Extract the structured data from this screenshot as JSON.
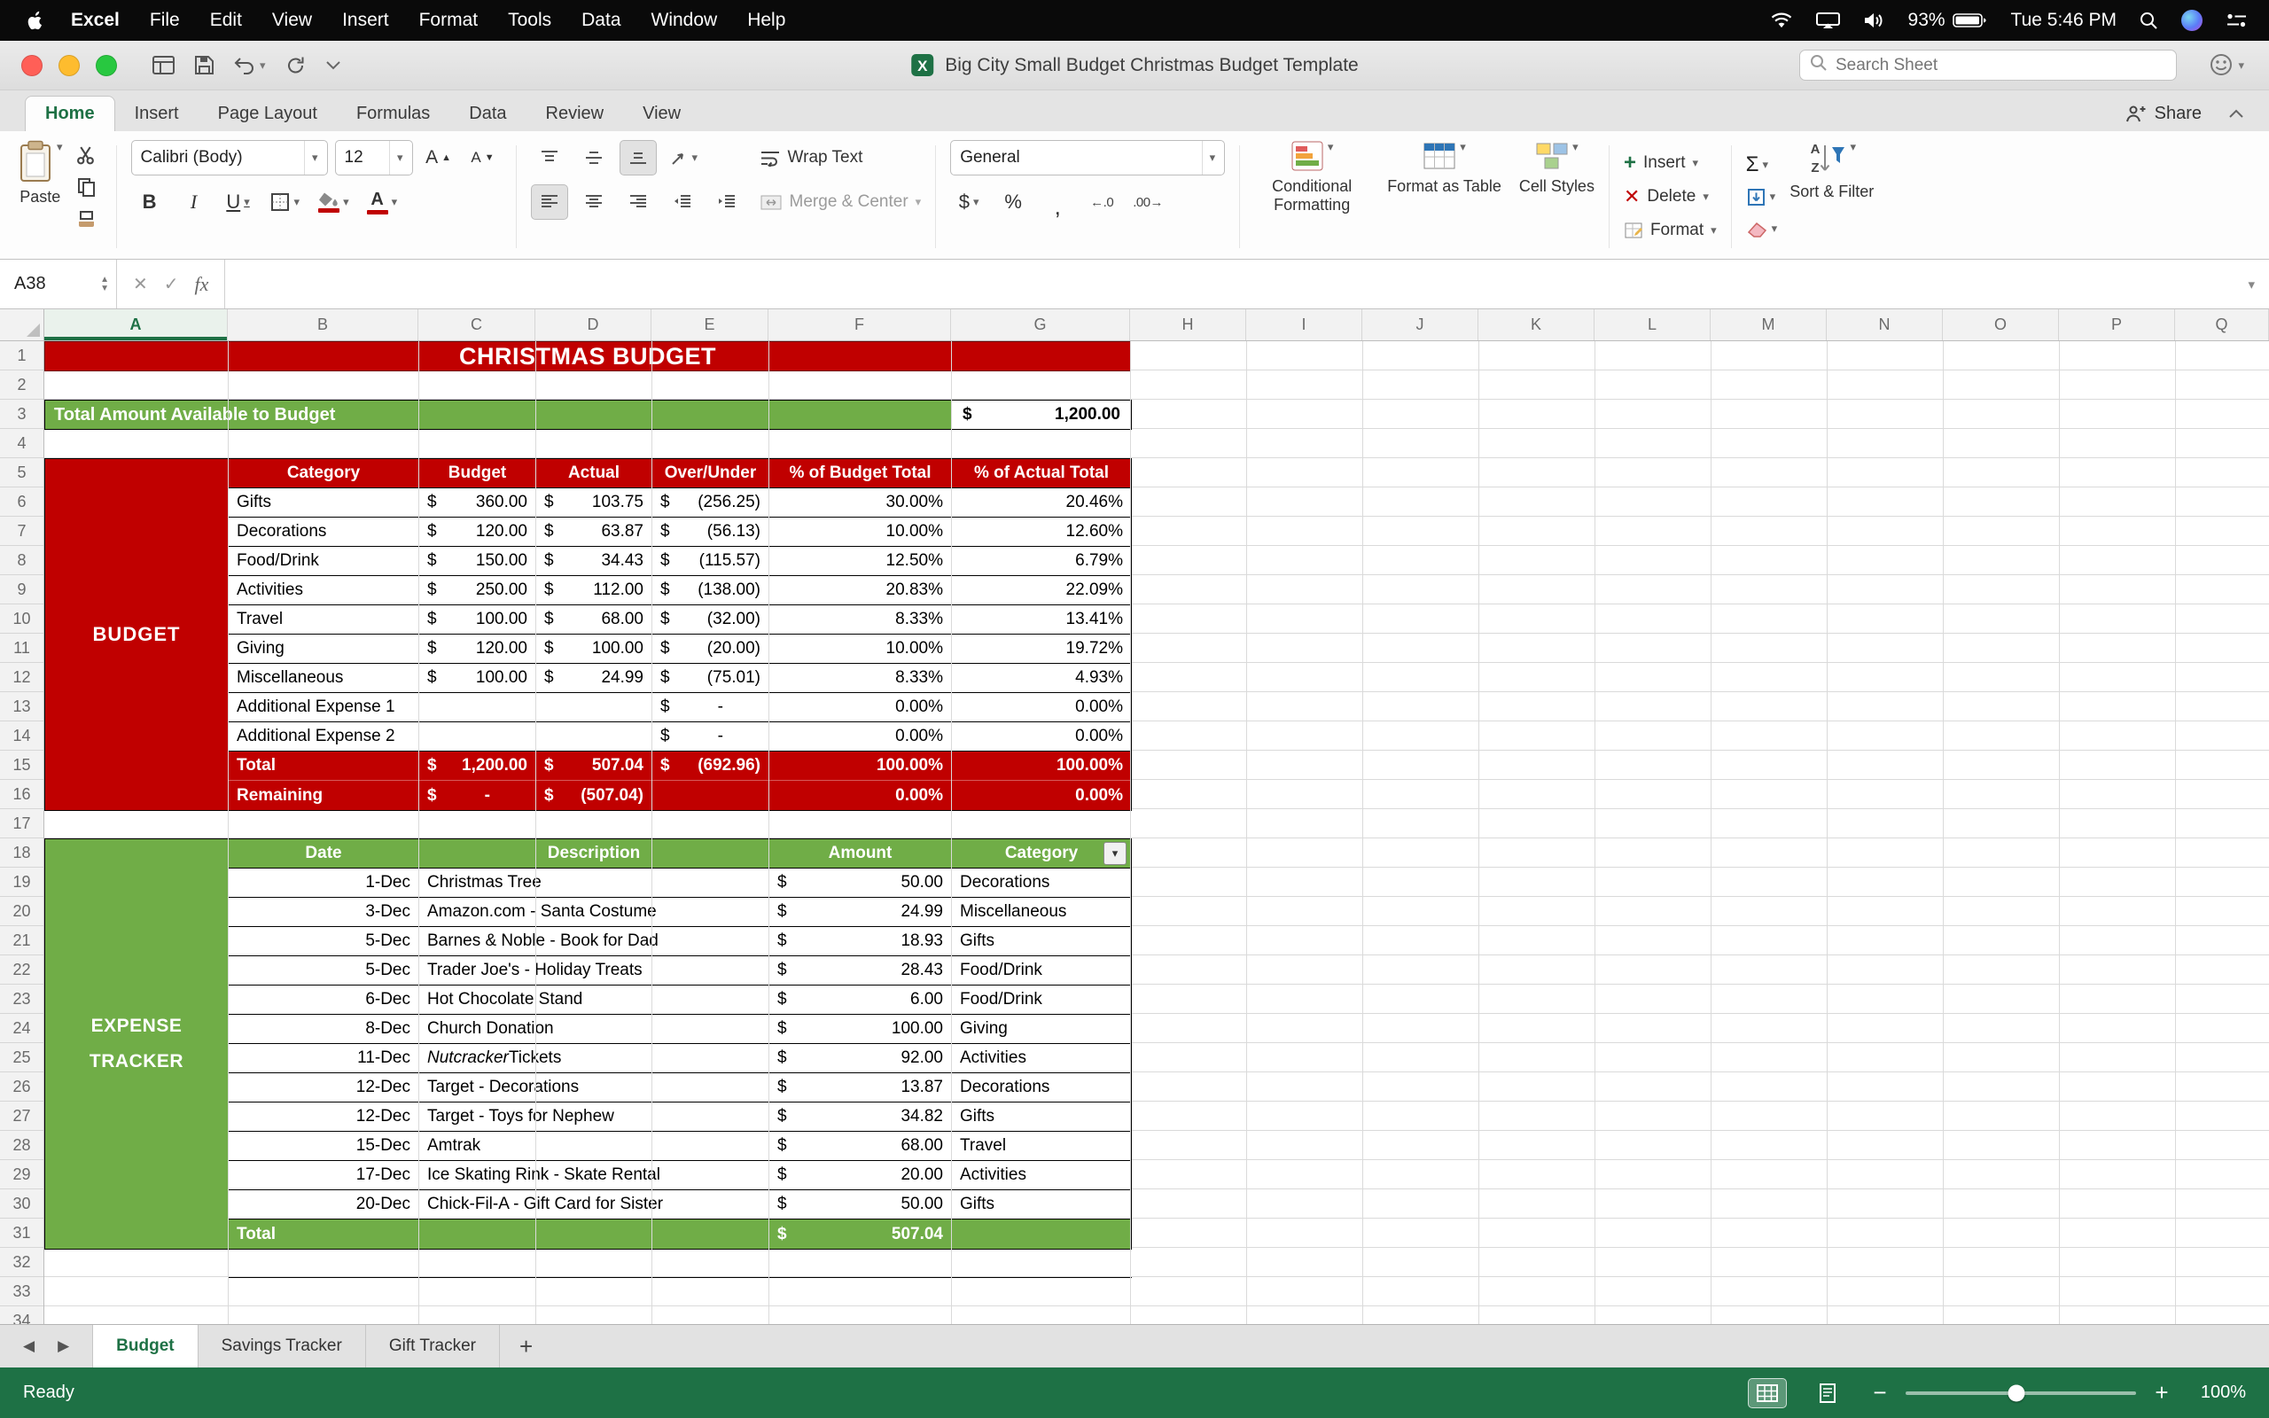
{
  "menubar": {
    "app": "Excel",
    "items": [
      "File",
      "Edit",
      "View",
      "Insert",
      "Format",
      "Tools",
      "Data",
      "Window",
      "Help"
    ],
    "battery": "93%",
    "clock": "Tue 5:46 PM"
  },
  "titlebar": {
    "doc_title": "Big City Small Budget Christmas Budget Template",
    "search_placeholder": "Search Sheet"
  },
  "ribbon": {
    "tabs": [
      "Home",
      "Insert",
      "Page Layout",
      "Formulas",
      "Data",
      "Review",
      "View"
    ],
    "active_tab": "Home",
    "share": "Share",
    "paste": "Paste",
    "font_name": "Calibri (Body)",
    "font_size": "12",
    "wrap_text": "Wrap Text",
    "merge_center": "Merge & Center",
    "number_format": "General",
    "conditional_formatting": "Conditional Formatting",
    "format_as_table": "Format as Table",
    "cell_styles": "Cell Styles",
    "insert": "Insert",
    "delete": "Delete",
    "format": "Format",
    "sort_filter": "Sort & Filter"
  },
  "formula_bar": {
    "name_box": "A38",
    "fx": "fx"
  },
  "grid": {
    "columns": [
      "A",
      "B",
      "C",
      "D",
      "E",
      "F",
      "G",
      "H",
      "I",
      "J",
      "K",
      "L",
      "M",
      "N",
      "O",
      "P",
      "Q"
    ],
    "selected_column": "A",
    "row_count": 34
  },
  "sheet": {
    "currency": "$",
    "title": "CHRISTMAS BUDGET",
    "available": {
      "label": "Total Amount Available to Budget",
      "currency": "$",
      "amount": "1,200.00"
    },
    "budget": {
      "side_label": "BUDGET",
      "headers": [
        "Category",
        "Budget",
        "Actual",
        "Over/Under",
        "% of Budget Total",
        "% of Actual Total"
      ],
      "rows": [
        {
          "kind": "data",
          "category": "Gifts",
          "budget": "360.00",
          "actual": "103.75",
          "over": "(256.25)",
          "pctb": "30.00%",
          "pcta": "20.46%"
        },
        {
          "kind": "data",
          "category": "Decorations",
          "budget": "120.00",
          "actual": "63.87",
          "over": "(56.13)",
          "pctb": "10.00%",
          "pcta": "12.60%"
        },
        {
          "kind": "data",
          "category": "Food/Drink",
          "budget": "150.00",
          "actual": "34.43",
          "over": "(115.57)",
          "pctb": "12.50%",
          "pcta": "6.79%"
        },
        {
          "kind": "data",
          "category": "Activities",
          "budget": "250.00",
          "actual": "112.00",
          "over": "(138.00)",
          "pctb": "20.83%",
          "pcta": "22.09%"
        },
        {
          "kind": "data",
          "category": "Travel",
          "budget": "100.00",
          "actual": "68.00",
          "over": "(32.00)",
          "pctb": "8.33%",
          "pcta": "13.41%"
        },
        {
          "kind": "data",
          "category": "Giving",
          "budget": "120.00",
          "actual": "100.00",
          "over": "(20.00)",
          "pctb": "10.00%",
          "pcta": "19.72%"
        },
        {
          "kind": "data",
          "category": "Miscellaneous",
          "budget": "100.00",
          "actual": "24.99",
          "over": "(75.01)",
          "pctb": "8.33%",
          "pcta": "4.93%"
        },
        {
          "kind": "plain",
          "category": "Additional Expense 1",
          "budget": "",
          "actual": "",
          "over": "-",
          "pctb": "0.00%",
          "pcta": "0.00%"
        },
        {
          "kind": "plain",
          "category": "Additional Expense 2",
          "budget": "",
          "actual": "",
          "over": "-",
          "pctb": "0.00%",
          "pcta": "0.00%"
        },
        {
          "kind": "total",
          "category": "Total",
          "budget": "1,200.00",
          "actual": "507.04",
          "over": "(692.96)",
          "pctb": "100.00%",
          "pcta": "100.00%"
        },
        {
          "kind": "remaining",
          "category": "Remaining",
          "budget": "-",
          "actual": "(507.04)",
          "over": "",
          "pctb": "0.00%",
          "pcta": "0.00%"
        }
      ]
    },
    "expenses": {
      "side_label": "EXPENSE TRACKER",
      "headers": [
        "Date",
        "Description",
        "Amount",
        "Category"
      ],
      "rows": [
        {
          "date": "1-Dec",
          "desc": "Christmas Tree",
          "amount": "50.00",
          "category": "Decorations"
        },
        {
          "date": "3-Dec",
          "desc": "Amazon.com - Santa Costume",
          "amount": "24.99",
          "category": "Miscellaneous"
        },
        {
          "date": "5-Dec",
          "desc": "Barnes & Noble - Book for Dad",
          "amount": "18.93",
          "category": "Gifts"
        },
        {
          "date": "5-Dec",
          "desc": "Trader Joe's - Holiday Treats",
          "amount": "28.43",
          "category": "Food/Drink"
        },
        {
          "date": "6-Dec",
          "desc": "Hot Chocolate Stand",
          "amount": "6.00",
          "category": "Food/Drink"
        },
        {
          "date": "8-Dec",
          "desc": "Church Donation",
          "amount": "100.00",
          "category": "Giving"
        },
        {
          "date": "11-Dec",
          "italic": "Nutcracker",
          "desc": " Tickets",
          "amount": "92.00",
          "category": "Activities"
        },
        {
          "date": "12-Dec",
          "desc": "Target - Decorations",
          "amount": "13.87",
          "category": "Decorations"
        },
        {
          "date": "12-Dec",
          "desc": "Target - Toys for Nephew",
          "amount": "34.82",
          "category": "Gifts"
        },
        {
          "date": "15-Dec",
          "desc": "Amtrak",
          "amount": "68.00",
          "category": "Travel"
        },
        {
          "date": "17-Dec",
          "desc": "Ice Skating Rink - Skate Rental",
          "amount": "20.00",
          "category": "Activities"
        },
        {
          "date": "20-Dec",
          "desc": "Chick-Fil-A - Gift Card for Sister",
          "amount": "50.00",
          "category": "Gifts"
        }
      ],
      "total_label": "Total",
      "total_amount": "507.04"
    }
  },
  "sheet_tabs": {
    "tabs": [
      "Budget",
      "Savings Tracker",
      "Gift Tracker"
    ],
    "active": "Budget"
  },
  "status_bar": {
    "status": "Ready",
    "zoom": "100%"
  }
}
